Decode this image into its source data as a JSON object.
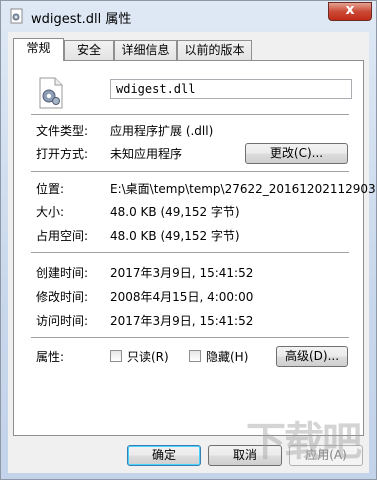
{
  "window": {
    "title": "wdigest.dll 属性",
    "close_glyph": "x"
  },
  "tabs": [
    {
      "label": "常规",
      "active": true
    },
    {
      "label": "安全",
      "active": false
    },
    {
      "label": "详细信息",
      "active": false
    },
    {
      "label": "以前的版本",
      "active": false
    }
  ],
  "general": {
    "file_name": "wdigest.dll",
    "file_type_label": "文件类型:",
    "file_type_value": "应用程序扩展 (.dll)",
    "opens_with_label": "打开方式:",
    "opens_with_value": "未知应用程序",
    "change_button": "更改(C)...",
    "location_label": "位置:",
    "location_value": "E:\\桌面\\temp\\temp\\27622_20161202112903",
    "size_label": "大小:",
    "size_value": "48.0 KB (49,152 字节)",
    "size_on_disk_label": "占用空间:",
    "size_on_disk_value": "48.0 KB (49,152 字节)",
    "created_label": "创建时间:",
    "created_value": "2017年3月9日, 15:41:52",
    "modified_label": "修改时间:",
    "modified_value": "2008年4月15日, 4:00:00",
    "accessed_label": "访问时间:",
    "accessed_value": "2017年3月9日, 15:41:52",
    "attributes_label": "属性:",
    "readonly_label": "只读(R)",
    "readonly_checked": false,
    "hidden_label": "隐藏(H)",
    "hidden_checked": false,
    "advanced_button": "高级(D)..."
  },
  "footer": {
    "ok_button": "确定",
    "cancel_button": "取消",
    "apply_button": "应用(A)"
  },
  "watermark": {
    "text": "下载吧"
  },
  "colors": {
    "title_bar": "#c9d8ec",
    "close_button": "#c42b1c",
    "default_button_border": "#3c7fb1"
  }
}
